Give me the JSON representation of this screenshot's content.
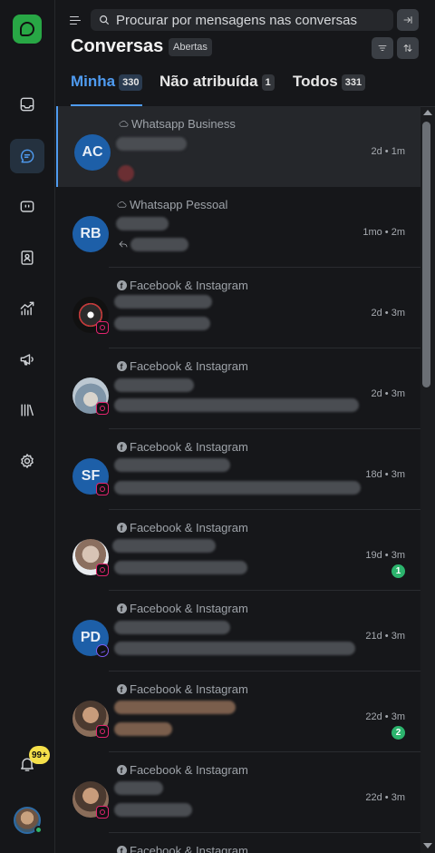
{
  "header": {
    "search_placeholder": "Procurar por mensagens nas conversas",
    "title": "Conversas",
    "status_filter": "Abertas"
  },
  "tabs": [
    {
      "label": "Minha",
      "count": "330",
      "active": true
    },
    {
      "label": "Não atribuída",
      "count": "1",
      "active": false
    },
    {
      "label": "Todos",
      "count": "331",
      "active": false
    }
  ],
  "sidebar": {
    "items": [
      {
        "icon": "inbox-icon"
      },
      {
        "icon": "conversations-icon",
        "active": true
      },
      {
        "icon": "captain-icon"
      },
      {
        "icon": "contacts-icon"
      },
      {
        "icon": "reports-icon"
      },
      {
        "icon": "campaigns-icon"
      },
      {
        "icon": "library-icon"
      },
      {
        "icon": "settings-icon"
      }
    ],
    "notifications_badge": "99+"
  },
  "conversations": [
    {
      "initials": "AC",
      "inbox": "Whatsapp Business",
      "channel": "whatsapp",
      "meta": "2d • 1m",
      "unread": "",
      "selected": true
    },
    {
      "initials": "RB",
      "inbox": "Whatsapp Pessoal",
      "channel": "whatsapp",
      "meta": "1mo • 2m",
      "unread": ""
    },
    {
      "initials": "",
      "inbox": "Facebook & Instagram",
      "channel": "instagram",
      "meta": "2d • 3m",
      "unread": ""
    },
    {
      "initials": "",
      "inbox": "Facebook & Instagram",
      "channel": "instagram",
      "meta": "2d • 3m",
      "unread": ""
    },
    {
      "initials": "SF",
      "inbox": "Facebook & Instagram",
      "channel": "instagram",
      "meta": "18d • 3m",
      "unread": ""
    },
    {
      "initials": "",
      "inbox": "Facebook & Instagram",
      "channel": "instagram",
      "meta": "19d • 3m",
      "unread": "1"
    },
    {
      "initials": "PD",
      "inbox": "Facebook & Instagram",
      "channel": "messenger",
      "meta": "21d • 3m",
      "unread": ""
    },
    {
      "initials": "",
      "inbox": "Facebook & Instagram",
      "channel": "instagram",
      "meta": "22d • 3m",
      "unread": "2"
    },
    {
      "initials": "",
      "inbox": "Facebook & Instagram",
      "channel": "instagram",
      "meta": "22d • 3m",
      "unread": ""
    },
    {
      "initials": "",
      "inbox": "Facebook & Instagram",
      "channel": "instagram",
      "meta": "",
      "unread": ""
    }
  ],
  "colors": {
    "accent": "#4f9bf0",
    "brand": "#28a745",
    "unread": "#2cb46d",
    "notification": "#f5e04a",
    "instagram": "#e2246f",
    "messenger": "#7d5cf5"
  }
}
